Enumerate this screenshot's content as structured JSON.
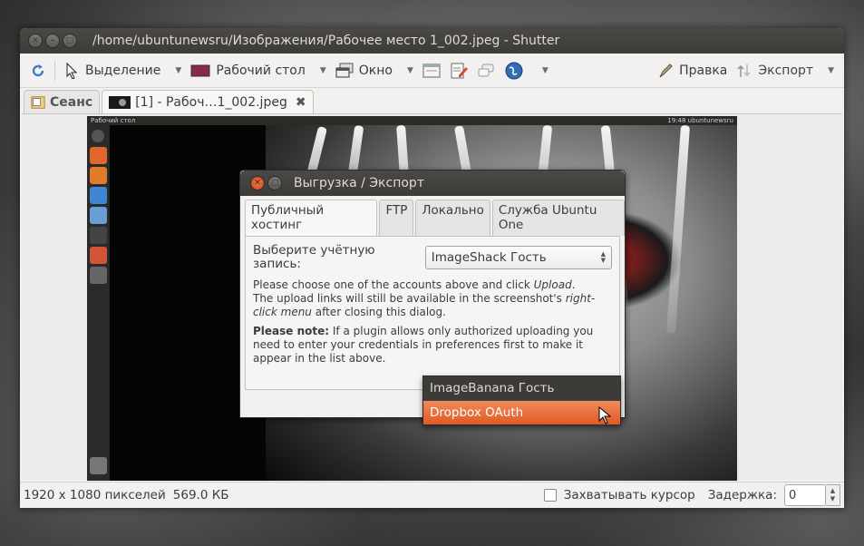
{
  "window": {
    "title": "/home/ubuntunewsru/Изображения/Рабочее место 1_002.jpeg - Shutter"
  },
  "toolbar": {
    "selection_label": "Выделение",
    "desktop_label": "Рабочий стол",
    "window_label": "Окно",
    "edit_label": "Правка",
    "export_label": "Экспорт"
  },
  "tabs": {
    "session_label": "Сеанс",
    "file_label": "[1] - Рабоч…1_002.jpeg"
  },
  "preview": {
    "panel_title": "Рабочий стол",
    "panel_right": "19:48  ubuntunewsru"
  },
  "dialog": {
    "title": "Выгрузка / Экспорт",
    "tabs": [
      "Публичный хостинг",
      "FTP",
      "Локально",
      "Служба Ubuntu One"
    ],
    "account_label": "Выберите учётную запись:",
    "account_value": "ImageShack Гость",
    "info_line1_a": "Please choose one of the accounts above and click ",
    "info_line1_em": "Upload",
    "info_line1_b": ".",
    "info_line2_a": "The upload links will still be available in the screenshot's ",
    "info_line2_em": "right-click menu",
    "info_line2_b": " after closing this dialog.",
    "note_bold": "Please note:",
    "note_text": " If a plugin allows only authorized uploading you need to enter your credentials in preferences first to make it appear in the list above."
  },
  "dropdown": {
    "items": [
      "ImageBanana Гость",
      "Dropbox OAuth"
    ],
    "selected_index": 1
  },
  "status": {
    "dimensions": "1920 x 1080 пикселей",
    "size": "569.0 КБ",
    "capture_cursor_label": "Захватывать курсор",
    "capture_cursor_checked": false,
    "delay_label": "Задержка:",
    "delay_value": "0"
  },
  "colors": {
    "accent": "#e05a23",
    "titlebar": "#3c3b37",
    "window_bg": "#f2f1f0"
  }
}
